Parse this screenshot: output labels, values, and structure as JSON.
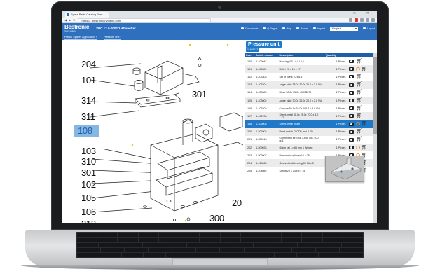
{
  "browser": {
    "tab_title": "Spare Parts Catalog Prev",
    "url": "https://...bestronic-hygiene.com",
    "window_controls": "— □ ✕"
  },
  "app": {
    "logo_name": "Bestronic",
    "logo_sub": "hygiene systems",
    "title": "SPC 13.0-0002 1 Alfanefter",
    "nav": [
      "Documents",
      "Q-Pages",
      "Help",
      "Basket",
      "Imprint"
    ],
    "language": "English",
    "logout": "Logout",
    "breadcrumbs": [
      "Plastic Spares Application ›",
      "Pressure unit ›"
    ]
  },
  "drawing": {
    "labels_left": [
      "204",
      "101",
      "314",
      "311",
      "108",
      "103",
      "310",
      "301",
      "102",
      "105",
      "106",
      "313"
    ],
    "label_selected": "108",
    "label_301_top": "301",
    "label_20": "20",
    "label_300": "300"
  },
  "panel": {
    "title": "Pressure unit",
    "id": "1-406012",
    "columns": [
      "Pos.",
      "Article number",
      "Description",
      "Quantity"
    ],
    "rows": [
      {
        "pos": "100",
        "art": "1-406047",
        "desc": "Housing 4,3 / 4,4 / 4,6",
        "qty": "1 Pieces",
        "link": false
      },
      {
        "pos": "101",
        "art": "1-405304",
        "desc": "Roller 20 x 15 x 17",
        "qty": "1 Pieces",
        "link": true
      },
      {
        "pos": "102",
        "art": "1-403303",
        "desc": "Set of rivets 10 x 6.5",
        "qty": "1 Pieces",
        "link": false
      },
      {
        "pos": "103",
        "art": "1-403304",
        "desc": "Angle plate 38.0x 30.0x 20.0 x 3.0 SW",
        "qty": "1 Pieces",
        "link": false
      },
      {
        "pos": "104",
        "art": "1-403305",
        "desc": "Block 30.0x 35.0x 40.0 B275",
        "qty": "1 Pieces",
        "link": false
      },
      {
        "pos": "105",
        "art": "1-403002",
        "desc": "Angle plate 30.0x 25.0x 20.0 x 2.0 SW",
        "qty": "1 Pieces",
        "link": false
      },
      {
        "pos": "106",
        "art": "1-403303",
        "desc": "Console 55.0x 32.0x 105.7 x 3.0 SW",
        "qty": "1 Pieces",
        "link": false
      },
      {
        "pos": "107",
        "art": "1-406708",
        "desc": "Sheet-metal 40.0x 25.0x 70.0 x 3.0 1.43",
        "qty": "1 Pieces",
        "link": false
      },
      {
        "pos": "108",
        "art": "1-406008",
        "desc": "Sheet-metal Insert",
        "qty": "1 Pieces",
        "link": true
      },
      {
        "pos": "200",
        "art": "1-507003",
        "desc": "Reed switch O-CTN, incl. LED",
        "qty": "1 Pieces",
        "link": false
      },
      {
        "pos": "201",
        "art": "1-509013",
        "desc": "Connecting strip for 3-Pol. incl. 200 nr/1",
        "qty": "1 Pieces",
        "link": false
      },
      {
        "pos": "202",
        "art": "1-509033",
        "desc": "Guide rail L= 65 mm 1 Wegen",
        "qty": "1 Pieces",
        "link": true
      },
      {
        "pos": "203",
        "art": "1-502007",
        "desc": "Pneumatic cylinder 10 x 25",
        "qty": "1 Pieces",
        "link": true
      },
      {
        "pos": "204",
        "art": "1-415028",
        "desc": "Grooved ball bearing 5 / 16 x 5",
        "qty": "1 Pieces",
        "link": true
      },
      {
        "pos": "205",
        "art": "1-404082",
        "desc": "Spring 20 x 24 x 8 x 15",
        "qty": "1 Pieces",
        "link": true
      }
    ],
    "selected_pos": "108"
  }
}
